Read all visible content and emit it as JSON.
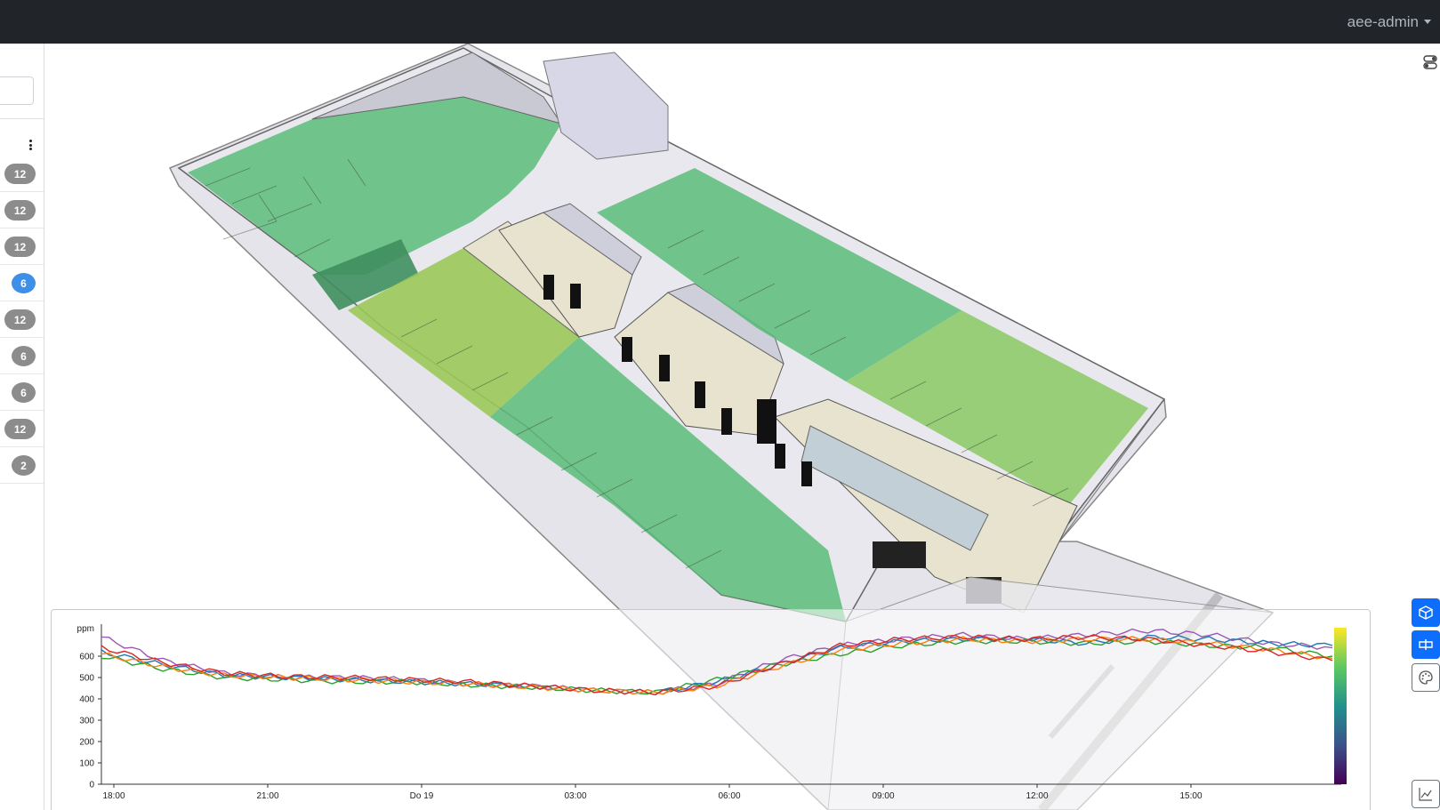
{
  "header": {
    "user_name": "aee-admin"
  },
  "sidebar": {
    "rooms": [
      {
        "count": "12",
        "active": false
      },
      {
        "count": "12",
        "active": false
      },
      {
        "count": "12",
        "active": false
      },
      {
        "count": "6",
        "active": true
      },
      {
        "count": "12",
        "active": false
      },
      {
        "count": "6",
        "active": false
      },
      {
        "count": "6",
        "active": false
      },
      {
        "count": "12",
        "active": false
      },
      {
        "count": "2",
        "active": false
      }
    ]
  },
  "icons": {
    "layer_toggle": "toggles-icon",
    "view_3d": "cube-icon",
    "view_floorplan": "floorplan-icon",
    "color_palette": "palette-icon",
    "chart_toggle": "line-chart-icon"
  },
  "colors": {
    "topbar": "#212529",
    "accent": "#0d6efd",
    "badge_default": "#8c8c8c",
    "badge_active": "#3d8fe8",
    "series": [
      "#9b59b6",
      "#1f77b4",
      "#2ca02c",
      "#ff7f0e",
      "#d62728"
    ]
  },
  "chart_data": {
    "type": "line",
    "ylabel": "ppm",
    "ylim": [
      0,
      700
    ],
    "yticks": [
      0,
      100,
      200,
      300,
      400,
      500,
      600
    ],
    "xtick_labels": [
      "18:00",
      "21:00",
      "Do 19",
      "03:00",
      "06:00",
      "09:00",
      "12:00",
      "15:00"
    ],
    "x_hours": [
      0,
      3,
      6,
      9,
      12,
      15,
      18,
      21,
      24
    ],
    "series": [
      {
        "color": "#9b59b6",
        "values": [
          690,
          580,
          520,
          500,
          500,
          490,
          470,
          460,
          440,
          430,
          470,
          580,
          650,
          680,
          700,
          680,
          700,
          720,
          700,
          660,
          640
        ]
      },
      {
        "color": "#1f77b4",
        "values": [
          620,
          560,
          510,
          500,
          490,
          480,
          470,
          460,
          440,
          430,
          480,
          560,
          640,
          670,
          680,
          680,
          660,
          690,
          680,
          660,
          650
        ]
      },
      {
        "color": "#2ca02c",
        "values": [
          600,
          540,
          500,
          490,
          480,
          480,
          465,
          455,
          440,
          430,
          490,
          560,
          610,
          650,
          670,
          670,
          660,
          670,
          650,
          640,
          600
        ]
      },
      {
        "color": "#ff7f0e",
        "values": [
          610,
          550,
          510,
          500,
          490,
          480,
          470,
          455,
          440,
          430,
          460,
          550,
          630,
          660,
          680,
          670,
          680,
          680,
          660,
          630,
          590
        ]
      },
      {
        "color": "#d62728",
        "values": [
          640,
          570,
          520,
          505,
          500,
          490,
          480,
          460,
          440,
          430,
          460,
          560,
          650,
          680,
          690,
          680,
          690,
          680,
          650,
          620,
          580
        ]
      }
    ]
  }
}
